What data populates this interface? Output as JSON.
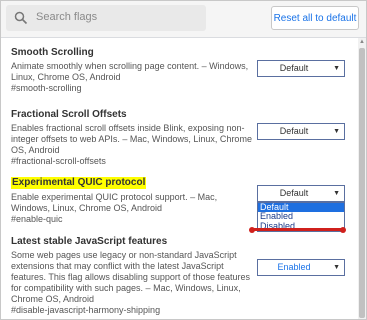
{
  "search": {
    "placeholder": "Search flags",
    "icon": "search-icon"
  },
  "reset_label": "Reset all to default",
  "flags": [
    {
      "title": "Smooth Scrolling",
      "desc": "Animate smoothly when scrolling page content. – Windows, Linux, Chrome OS, Android",
      "link": "#smooth-scrolling",
      "value": "Default"
    },
    {
      "title": "Fractional Scroll Offsets",
      "desc": "Enables fractional scroll offsets inside Blink, exposing non-integer offsets to web APIs. – Mac, Windows, Linux, Chrome OS, Android",
      "link": "#fractional-scroll-offsets",
      "value": "Default"
    },
    {
      "title": "Experimental QUIC protocol",
      "desc": "Enable experimental QUIC protocol support. – Mac, Windows, Linux, Chrome OS, Android",
      "link": "#enable-quic",
      "value": "Default",
      "options": [
        "Default",
        "Enabled",
        "Disabled"
      ]
    },
    {
      "title": "Latest stable JavaScript features",
      "desc": "Some web pages use legacy or non-standard JavaScript extensions that may conflict with the latest JavaScript features. This flag allows disabling support of those features for compatibility with such pages. – Mac, Windows, Linux, Chrome OS, Android",
      "link": "#disable-javascript-harmony-shipping",
      "value": "Enabled"
    }
  ],
  "colors": {
    "highlight": "#ffff00",
    "link_blue": "#1a73e8",
    "annotation_red": "#d0201c"
  }
}
